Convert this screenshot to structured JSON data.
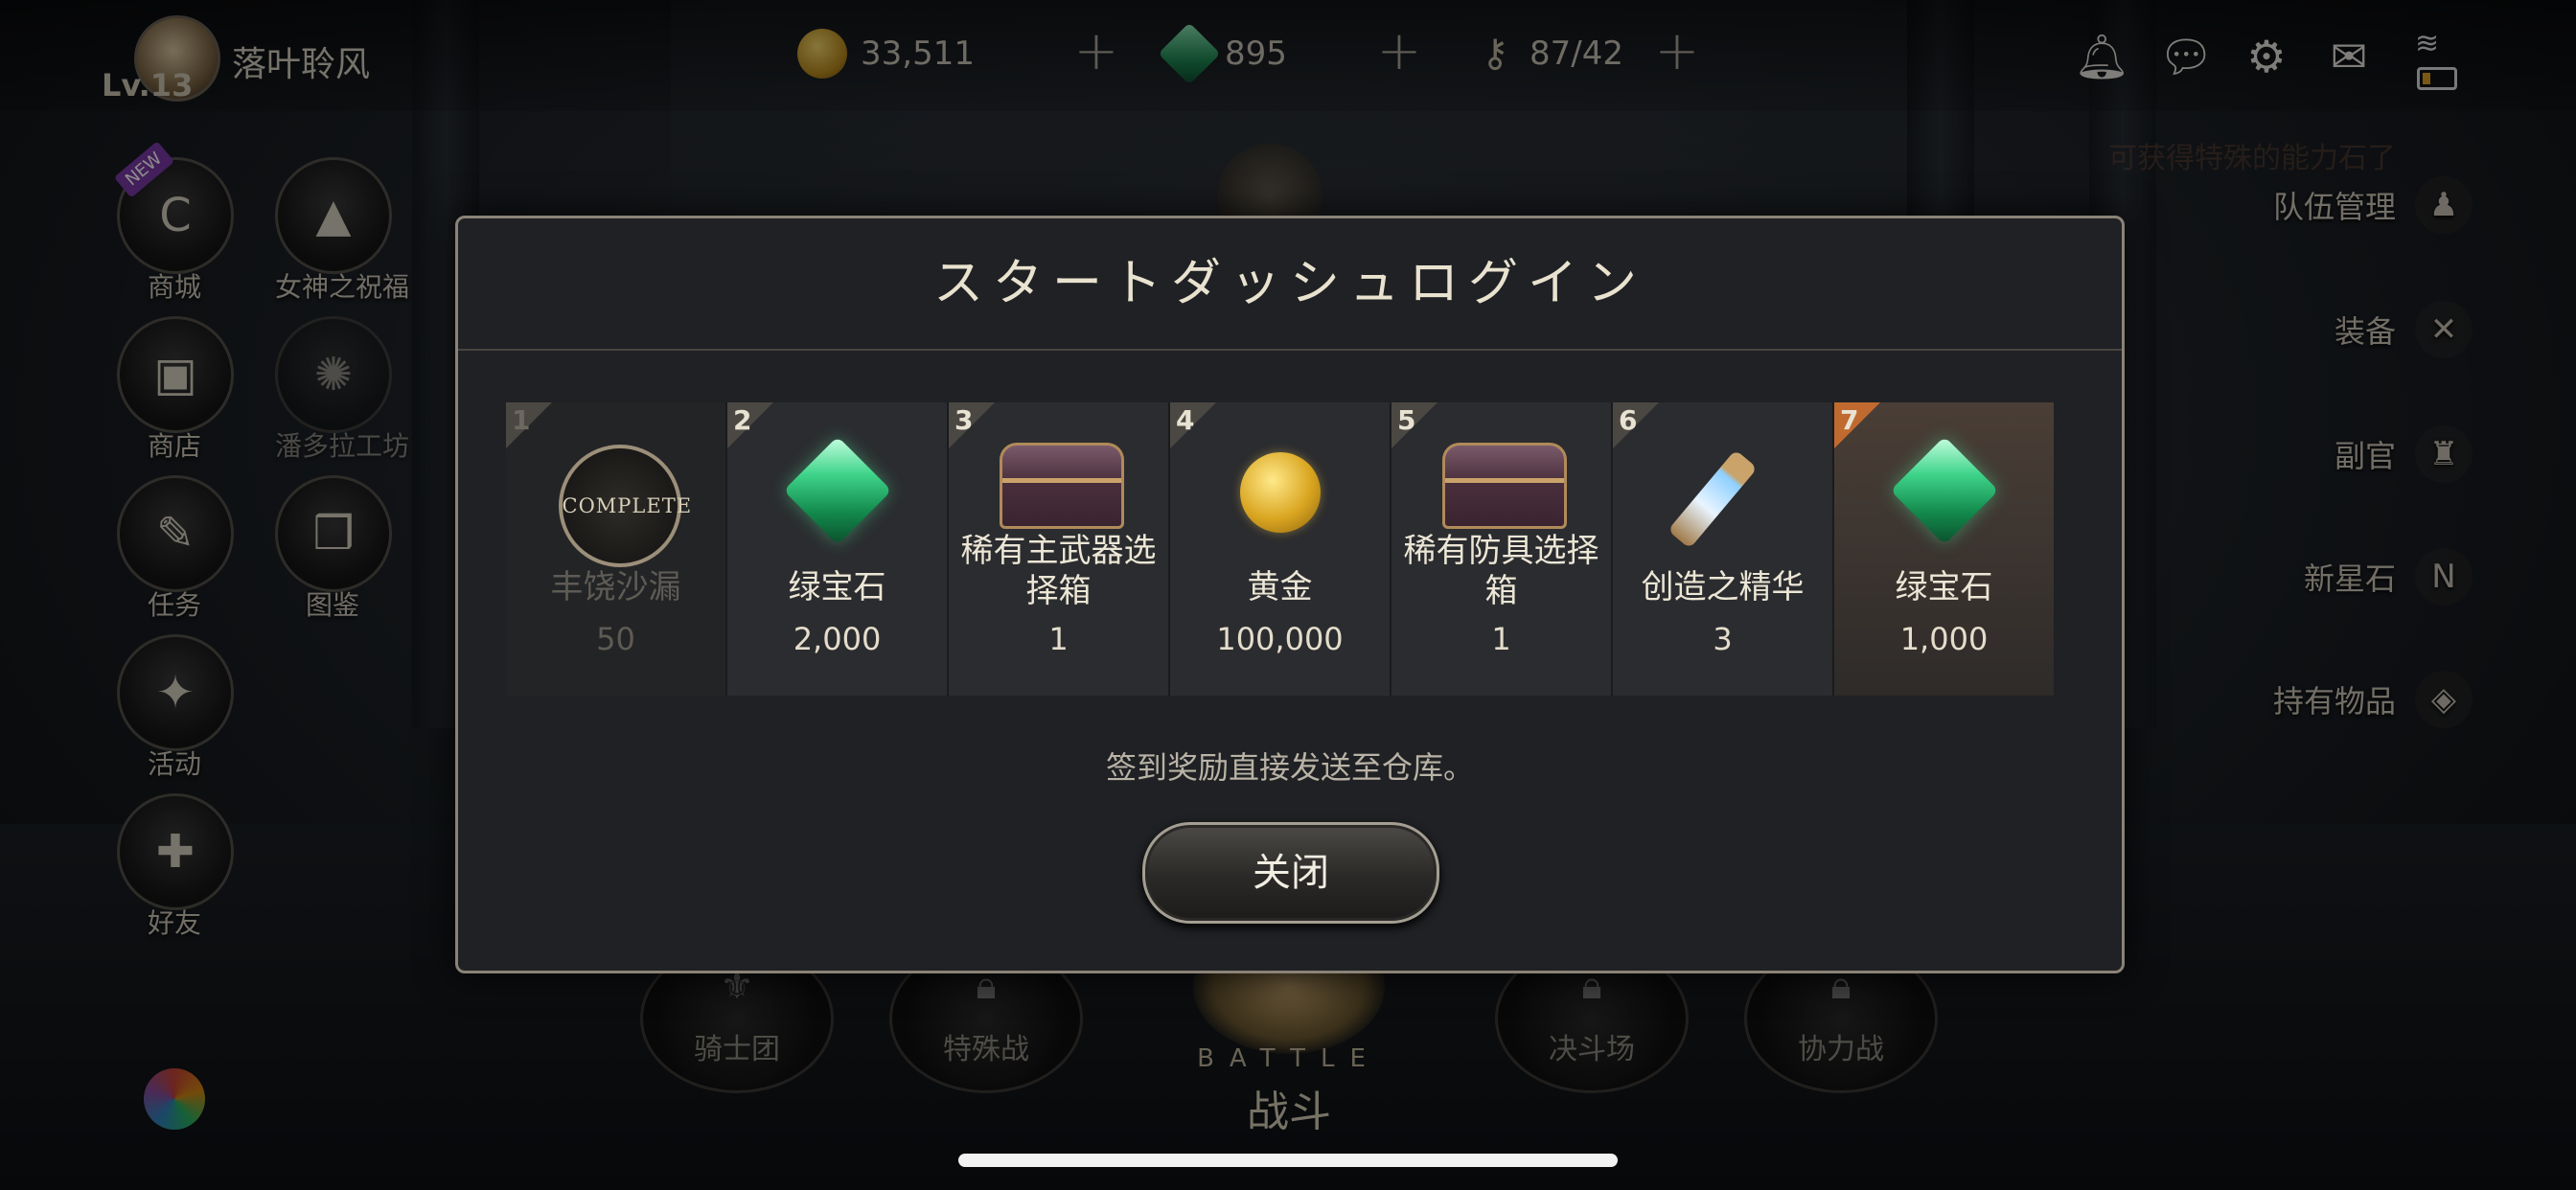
{
  "player": {
    "level": "Lv.13",
    "name": "落叶聆风"
  },
  "currency": {
    "gold": "33,511",
    "gems": "895",
    "stamina": "87/42"
  },
  "left_menu": [
    {
      "label": "商城",
      "icon": "shop-c-icon",
      "glyph": "C",
      "badge": "NEW"
    },
    {
      "label": "女神之祝福",
      "icon": "goddess-icon",
      "glyph": "▲"
    },
    {
      "label": "商店",
      "icon": "chest-store-icon",
      "glyph": "▣"
    },
    {
      "label": "潘多拉工坊",
      "icon": "pandora-lock-icon",
      "glyph": "✺"
    },
    {
      "label": "任务",
      "icon": "scroll-quest-icon",
      "glyph": "✎"
    },
    {
      "label": "图鉴",
      "icon": "book-icon",
      "glyph": "❒"
    },
    {
      "label": "活动",
      "icon": "gift-icon",
      "glyph": "✦"
    },
    {
      "label": "好友",
      "icon": "add-friend-icon",
      "glyph": "✚"
    }
  ],
  "right_menu": {
    "notice": "可获得特殊的能力石了",
    "items": [
      {
        "label": "队伍管理",
        "icon": "team-icon",
        "glyph": "♟"
      },
      {
        "label": "装备",
        "icon": "swords-icon",
        "glyph": "✕"
      },
      {
        "label": "副官",
        "icon": "helmet-icon",
        "glyph": "♜"
      },
      {
        "label": "新星石",
        "icon": "stone-icon",
        "glyph": "N"
      },
      {
        "label": "持有物品",
        "icon": "bag-icon",
        "glyph": "◈"
      }
    ]
  },
  "battle_bar": {
    "knights": "骑士团",
    "special": "特殊战",
    "duel": "决斗场",
    "coop": "协力战",
    "battle_en": "BATTLE",
    "battle_zh": "战斗"
  },
  "modal": {
    "title": "スタートダッシュログイン",
    "days": [
      {
        "day": "1",
        "name": "丰饶沙漏",
        "qty": "50",
        "icon": "complete-stamp-icon",
        "stamp": "COMPLETE",
        "state": "done"
      },
      {
        "day": "2",
        "name": "绿宝石",
        "qty": "2,000",
        "icon": "emerald-icon",
        "state": "normal"
      },
      {
        "day": "3",
        "name": "稀有主武器选择箱",
        "qty": "1",
        "icon": "weapon-chest-icon",
        "state": "normal"
      },
      {
        "day": "4",
        "name": "黄金",
        "qty": "100,000",
        "icon": "gold-coin-icon",
        "state": "normal"
      },
      {
        "day": "5",
        "name": "稀有防具选择箱",
        "qty": "1",
        "icon": "armor-chest-icon",
        "state": "normal"
      },
      {
        "day": "6",
        "name": "创造之精华",
        "qty": "3",
        "icon": "essence-vial-icon",
        "state": "normal"
      },
      {
        "day": "7",
        "name": "绿宝石",
        "qty": "1,000",
        "icon": "emerald-icon",
        "state": "today"
      }
    ],
    "notice": "签到奖励直接发送至仓库。",
    "close_label": "关闭"
  }
}
